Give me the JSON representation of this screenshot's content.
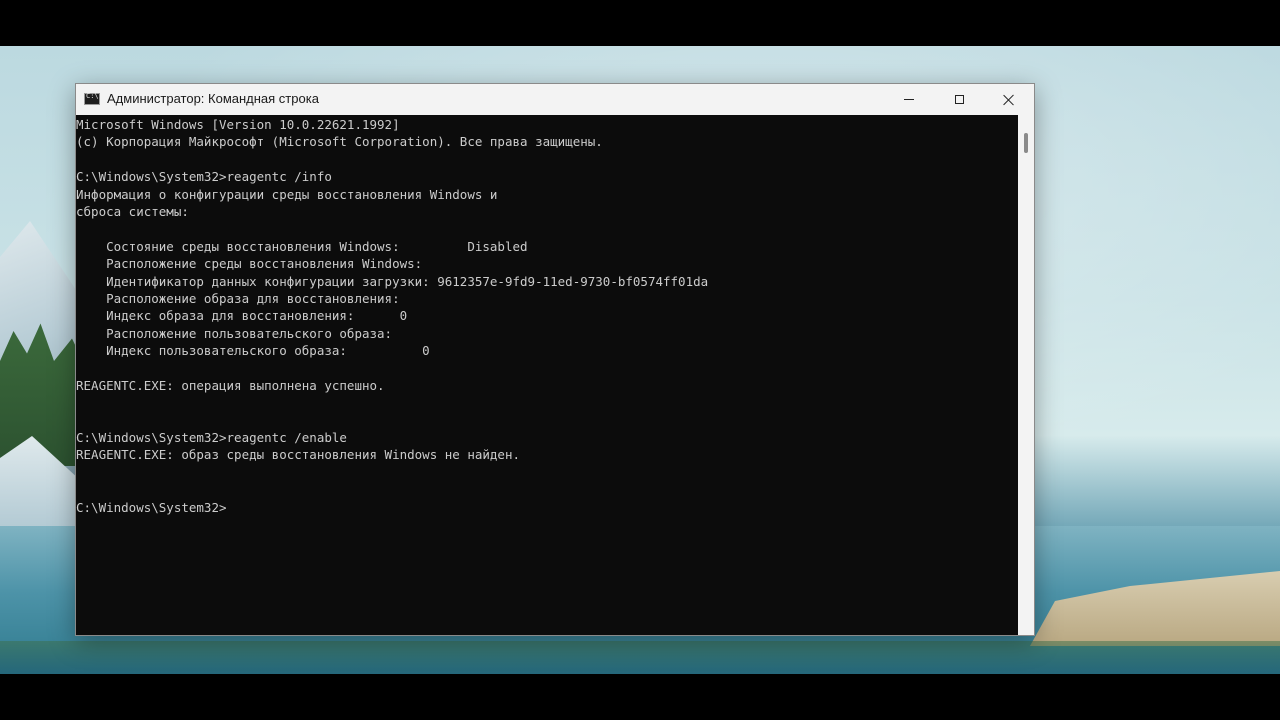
{
  "window": {
    "title": "Администратор: Командная строка",
    "icon": "cmd-icon",
    "controls": {
      "minimize": "minimize-icon",
      "maximize": "maximize-icon",
      "close": "close-icon"
    }
  },
  "console": {
    "lines": [
      "Microsoft Windows [Version 10.0.22621.1992]",
      "(c) Корпорация Майкрософт (Microsoft Corporation). Все права защищены.",
      "",
      "C:\\Windows\\System32>reagentc /info",
      "Информация о конфигурации среды восстановления Windows и",
      "сброса системы:",
      "",
      "    Состояние среды восстановления Windows:         Disabled",
      "    Расположение среды восстановления Windows:",
      "    Идентификатор данных конфигурации загрузки: 9612357e-9fd9-11ed-9730-bf0574ff01da",
      "    Расположение образа для восстановления:",
      "    Индекс образа для восстановления:      0",
      "    Расположение пользовательского образа:",
      "    Индекс пользовательского образа:          0",
      "",
      "REAGENTC.EXE: операция выполнена успешно.",
      "",
      "",
      "C:\\Windows\\System32>reagentc /enable",
      "REAGENTC.EXE: образ среды восстановления Windows не найден.",
      "",
      "",
      "C:\\Windows\\System32>"
    ]
  },
  "colors": {
    "console_bg": "#0c0c0c",
    "console_text": "#cccccc",
    "titlebar_bg": "#f3f3f3"
  }
}
